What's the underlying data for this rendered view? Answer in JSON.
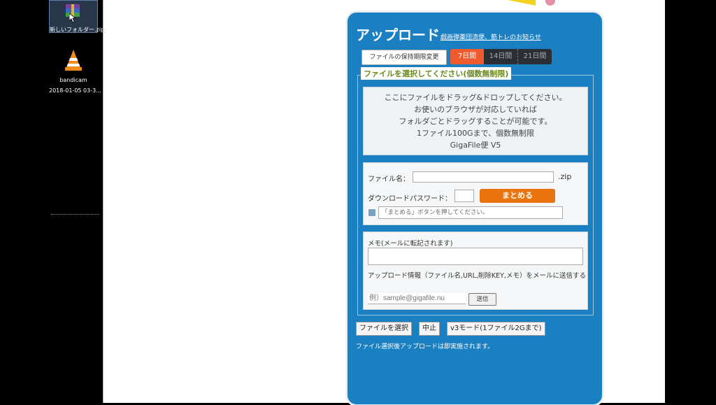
{
  "desktop": {
    "zip_label": "新しいフォルダー.zip",
    "bandicam_label": "bandicam",
    "bandicam_sub": "2018-01-05 03-3..."
  },
  "upload": {
    "title": "アップロード",
    "notice_link": "戯画弾薬団流便、筋トレのお知らせ",
    "retention_button": "ファイルの保持期限変更",
    "periods": [
      "7日間",
      "14日間",
      "21日間"
    ],
    "select_legend": "ファイルを選択してください(個数無制限)",
    "drop_lines": [
      "ここにファイルをドラッグ&ドロップしてください。",
      "お使いのブラウザが対応していれば",
      "フォルダごとドラッグすることが可能です。",
      "1ファイル100Gまで、個数無制限",
      "GigaFile便 V5"
    ],
    "filename_label": "ファイル名：",
    "filename_value": "",
    "ext": ".zip",
    "password_label": "ダウンロードパスワード：",
    "matome_button": "まとめる",
    "status_text": "「まとめる」ボタンを押してください。",
    "memo_label": "メモ(メールに転記されます)",
    "info_text": "アップロード情報（ファイル名,URL,削除KEY,メモ）をメールに送信する",
    "email_placeholder": "例）sample@gigafile.nu",
    "send_button": "送信",
    "buttons": [
      "ファイルを選択",
      "中止",
      "v3モード(1ファイル2Gまで)"
    ],
    "footer_note": "ファイル選択後アップロードは即実施されます。"
  },
  "colors": {
    "card_blue": "#1b80c2",
    "active_period": "#ef5a2e",
    "matome_orange": "#e9740e",
    "legend_green": "#6a8a1c"
  }
}
